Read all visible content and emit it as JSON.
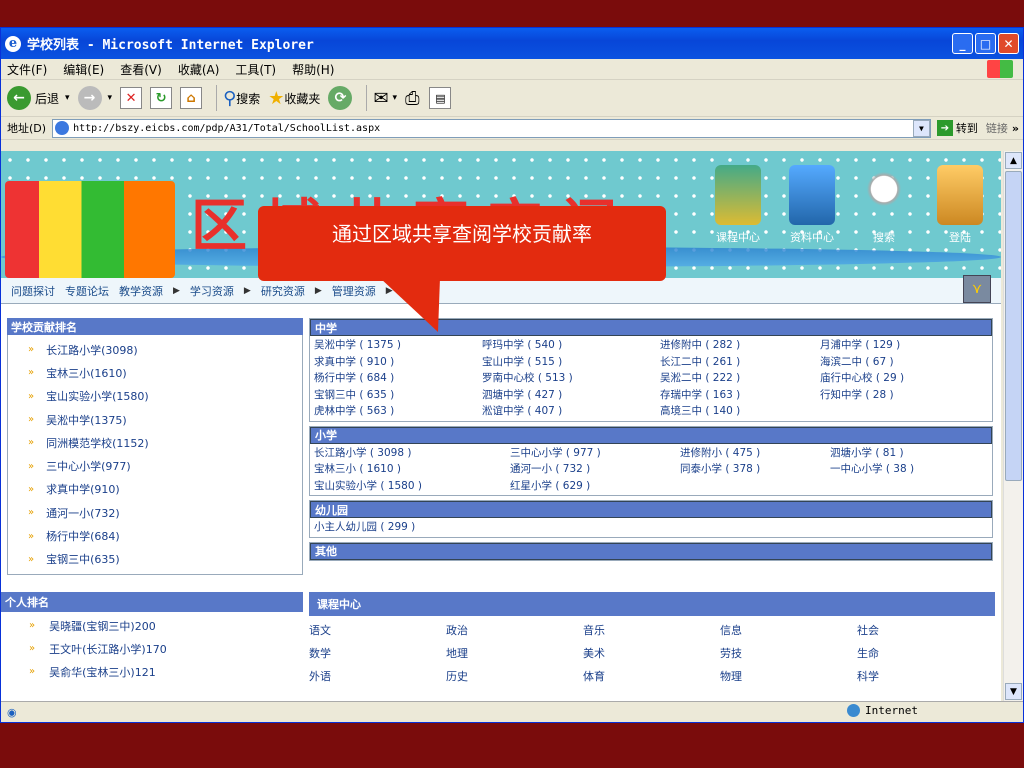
{
  "window": {
    "title": "学校列表 - Microsoft Internet Explorer",
    "icon": "ie-icon"
  },
  "menu": [
    "文件(F)",
    "编辑(E)",
    "查看(V)",
    "收藏(A)",
    "工具(T)",
    "帮助(H)"
  ],
  "toolbar": {
    "back": "后退",
    "search": "搜索",
    "favorites": "收藏夹"
  },
  "address": {
    "label": "地址(D)",
    "url": "http://bszy.eicbs.com/pdp/A31/Total/SchoolList.aspx",
    "go": "转到",
    "links": "链接"
  },
  "banner": {
    "title": "区域共享空间",
    "nav": [
      "课程中心",
      "资料中心",
      "搜索",
      "登陆"
    ]
  },
  "callout": "通过区域共享查阅学校贡献率",
  "navbar": [
    "问题探讨",
    "专题论坛",
    "教学资源",
    "学习资源",
    "研究资源",
    "管理资源"
  ],
  "left": {
    "header": "学校贡献排名",
    "items": [
      "长江路小学(3098)",
      "宝林三小(1610)",
      "宝山实验小学(1580)",
      "吴淞中学(1375)",
      "同洲模范学校(1152)",
      "三中心小学(977)",
      "求真中学(910)",
      "通河一小(732)",
      "杨行中学(684)",
      "宝钢三中(635)"
    ]
  },
  "person": {
    "header": "个人排名",
    "items": [
      "吴晓疆(宝钢三中)200",
      "王文叶(长江路小学)170",
      "吴俞华(宝林三小)121"
    ]
  },
  "sections": {
    "middle": {
      "header": "中学",
      "items": [
        "吴淞中学 ( 1375 )",
        "呼玛中学 ( 540 )",
        "进修附中 ( 282 )",
        "月浦中学 ( 129 )",
        "求真中学 ( 910 )",
        "宝山中学 ( 515 )",
        "长江二中 ( 261 )",
        "海滨二中 ( 67 )",
        "杨行中学 ( 684 )",
        "罗南中心校 ( 513 )",
        "吴淞二中 ( 222 )",
        "庙行中心校 ( 29 )",
        "宝钢三中 ( 635 )",
        "泗塘中学 ( 427 )",
        "存瑞中学 ( 163 )",
        "行知中学 ( 28 )",
        "虎林中学 ( 563 )",
        "淞谊中学 ( 407 )",
        "高境三中 ( 140 )",
        ""
      ]
    },
    "primary": {
      "header": "小学",
      "items": [
        "长江路小学 ( 3098 )",
        "三中心小学 ( 977 )",
        "进修附小 ( 475 )",
        "泗塘小学 ( 81 )",
        "宝林三小 ( 1610 )",
        "通河一小 ( 732 )",
        "同泰小学 ( 378 )",
        "一中心小学 ( 38 )",
        "宝山实验小学 ( 1580 )",
        "红星小学 ( 629 )",
        "",
        ""
      ]
    },
    "kinder": {
      "header": "幼儿园",
      "items": [
        "小主人幼儿园 ( 299 )"
      ]
    },
    "other": {
      "header": "其他"
    }
  },
  "course": {
    "header": "课程中心",
    "items": [
      "语文",
      "政治",
      "音乐",
      "信息",
      "社会",
      "数学",
      "地理",
      "美术",
      "劳技",
      "生命",
      "外语",
      "历史",
      "体育",
      "物理",
      "科学"
    ]
  },
  "status": {
    "zone": "Internet"
  }
}
